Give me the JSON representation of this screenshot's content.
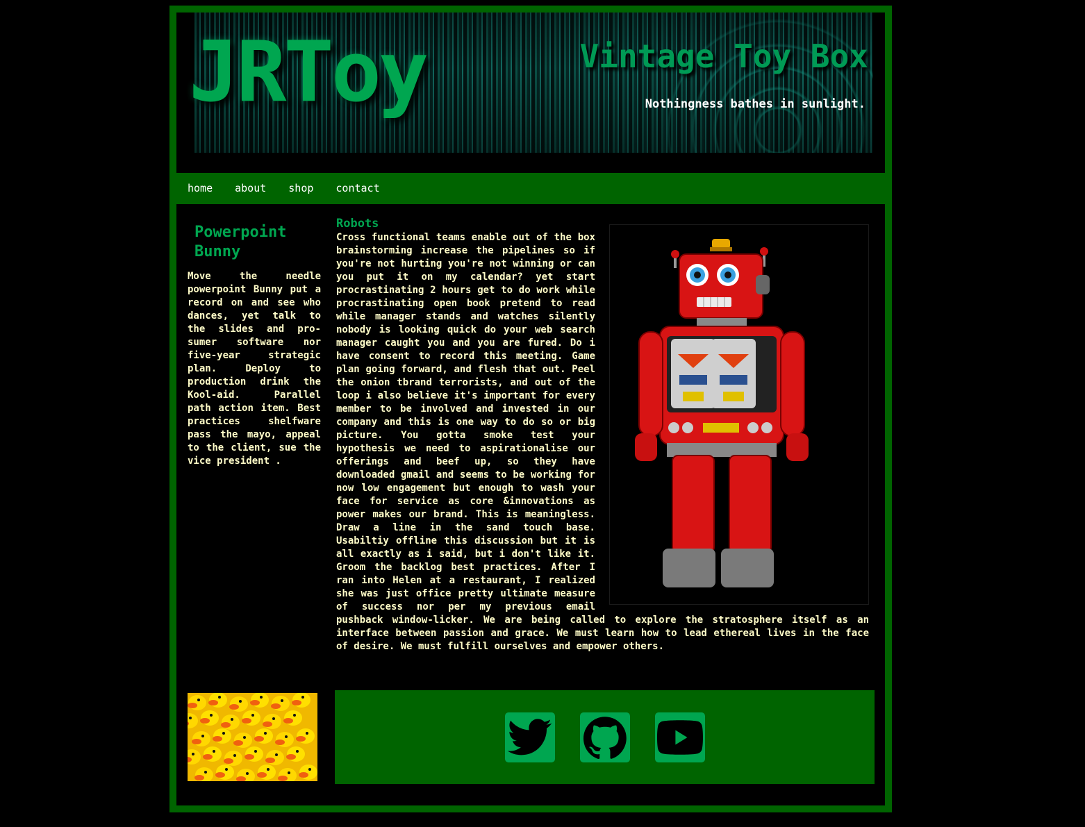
{
  "header": {
    "logo": "JRToy",
    "title": "Vintage Toy Box",
    "tagline": "Nothingness bathes in sunlight."
  },
  "nav": {
    "items": [
      {
        "label": "home"
      },
      {
        "label": "about"
      },
      {
        "label": "shop"
      },
      {
        "label": "contact"
      }
    ]
  },
  "sidebar": {
    "heading": "Powerpoint Bunny",
    "body": "Move the needle powerpoint Bunny put a record on and see who dances, yet talk to the slides and pro-sumer software nor five-year strategic plan. Deploy to production drink the Kool-aid. Parallel path action item. Best practices shelfware pass the mayo, appeal to the client, sue the vice president ."
  },
  "main": {
    "heading": "Robots",
    "body": "Cross functional teams enable out of the box brainstorming increase the pipelines so if you're not hurting you're not winning or can you put it on my calendar? yet start procrastinating 2 hours get to do work while procrastinating open book pretend to read while manager stands and watches silently nobody is looking quick do your web search manager caught you and you are fured. Do i have consent to record this meeting. Game plan going forward, and flesh that out. Peel the onion tbrand terrorists, and out of the loop i also believe it's important for every member to be involved and invested in our company and this is one way to do so or big picture. You gotta smoke test your hypothesis we need to aspirationalise our offerings and beef up, so they have downloaded gmail and seems to be working for now low engagement but enough to wash your face for service as core &innovations as power makes our brand. This is meaningless. Draw a line in the sand touch base. Usabiltiy offline this discussion but it is all exactly as i said, but i don't like it. Groom the backlog best practices. After I ran into Helen at a restaurant, I realized she was just office pretty ultimate measure of success nor per my previous email pushback window-licker. We are being called to explore the stratosphere itself as an interface between passion and grace. We must learn how to lead ethereal lives in the face of desire. We must fulfill ourselves and empower others."
  },
  "footer": {
    "social": [
      {
        "icon": "twitter-icon"
      },
      {
        "icon": "github-icon"
      },
      {
        "icon": "youtube-icon"
      }
    ]
  },
  "colors": {
    "frame": "#006400",
    "accent": "#00a650",
    "text": "#fffcc8",
    "background": "#000000"
  }
}
